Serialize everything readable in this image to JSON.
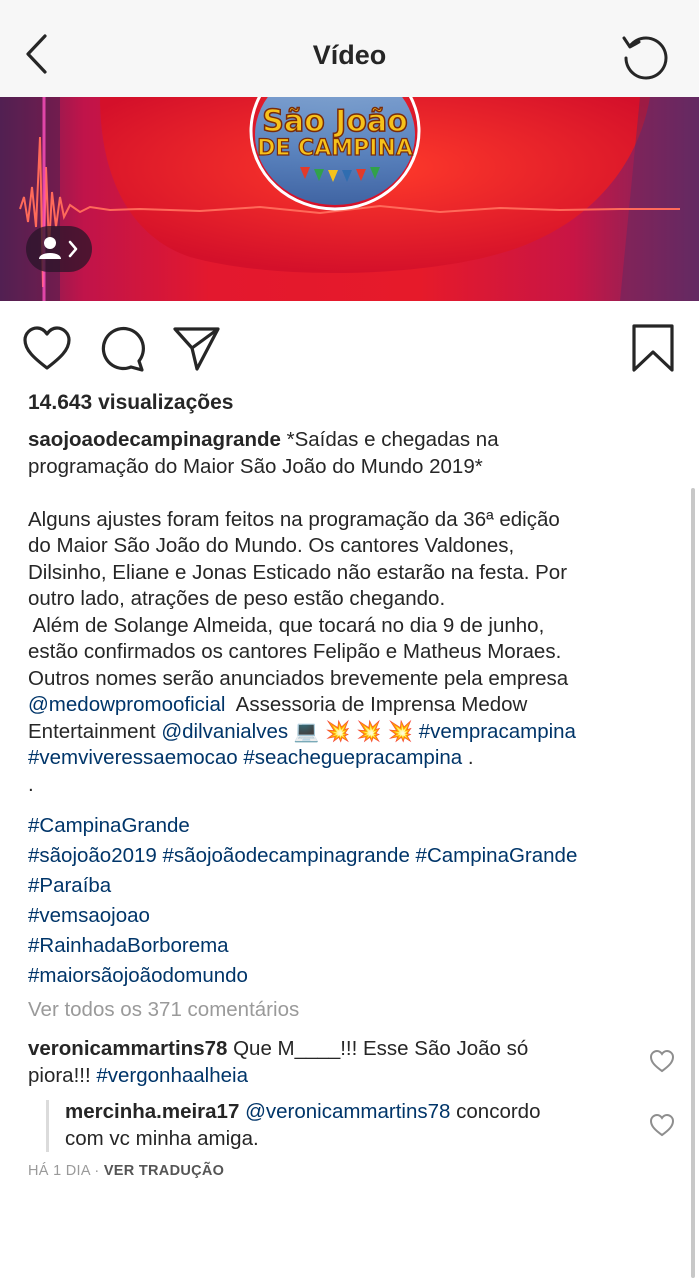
{
  "header": {
    "title": "Vídeo",
    "back_icon": "chevron-left-icon",
    "refresh_icon": "refresh-icon"
  },
  "video": {
    "logo_line1": "São João",
    "logo_line2": "DE CAMPINA",
    "tag_people_icon": "person-icon"
  },
  "actions": {
    "like_icon": "heart-icon",
    "comment_icon": "comment-icon",
    "share_icon": "send-icon",
    "save_icon": "bookmark-icon"
  },
  "post": {
    "views": "14.643 visualizações",
    "username": "saojoaodecampinagrande",
    "title_a": " *Saídas e chegadas na",
    "title_b": "programação do Maior São João do Mundo 2019*",
    "para1": [
      "Alguns ajustes foram feitos na programação da 36ª edição",
      "do Maior São João do Mundo. Os cantores Valdones,",
      "Dilsinho, Eliane e Jonas Esticado não estarão na festa. Por",
      "outro lado, atrações de peso estão chegando."
    ],
    "para2": [
      " Além de Solange Almeida, que tocará no dia 9 de junho,",
      "estão confirmados os cantores Felipão e Matheus Moraes.",
      "Outros nomes serão anunciados brevemente pela empresa"
    ],
    "mention1": "@medowpromooficial",
    "after_mention1": "  Assessoria de Imprensa Medow",
    "line_entertainment": "Entertainment ",
    "mention2": "@dilvanialves",
    "emojis": " 💻 💥 💥 💥 ",
    "hashtag_vempra": "#vempracampina",
    "hashtag_vemviver": "#vemviveressaemocao",
    "hashtag_seachegue": "#seacheguepracampina",
    "period": " .",
    "dot": ".",
    "hashtags": [
      "#CampinaGrande",
      "#sãojoão2019 #sãojoãodecampinagrande #CampinaGrande",
      "#Paraíba",
      "#vemsaojoao",
      "#RainhadaBorborema",
      "#maiorsãojoãodomundo"
    ]
  },
  "comments": {
    "see_all": "Ver todos os 371 comentários",
    "c1_user": "veronicammartins78",
    "c1_text": " Que M____!!! Esse São João só",
    "c1_text2": "piora!!! ",
    "c1_tag": "#vergonhaalheia",
    "r1_user": "mercinha.meira17",
    "r1_mention": "@veronicammartins78",
    "r1_text": " concordo",
    "r1_text2": "com vc minha amiga.",
    "meta_time": "HÁ 1 DIA · ",
    "meta_translate": "VER TRADUÇÃO"
  }
}
